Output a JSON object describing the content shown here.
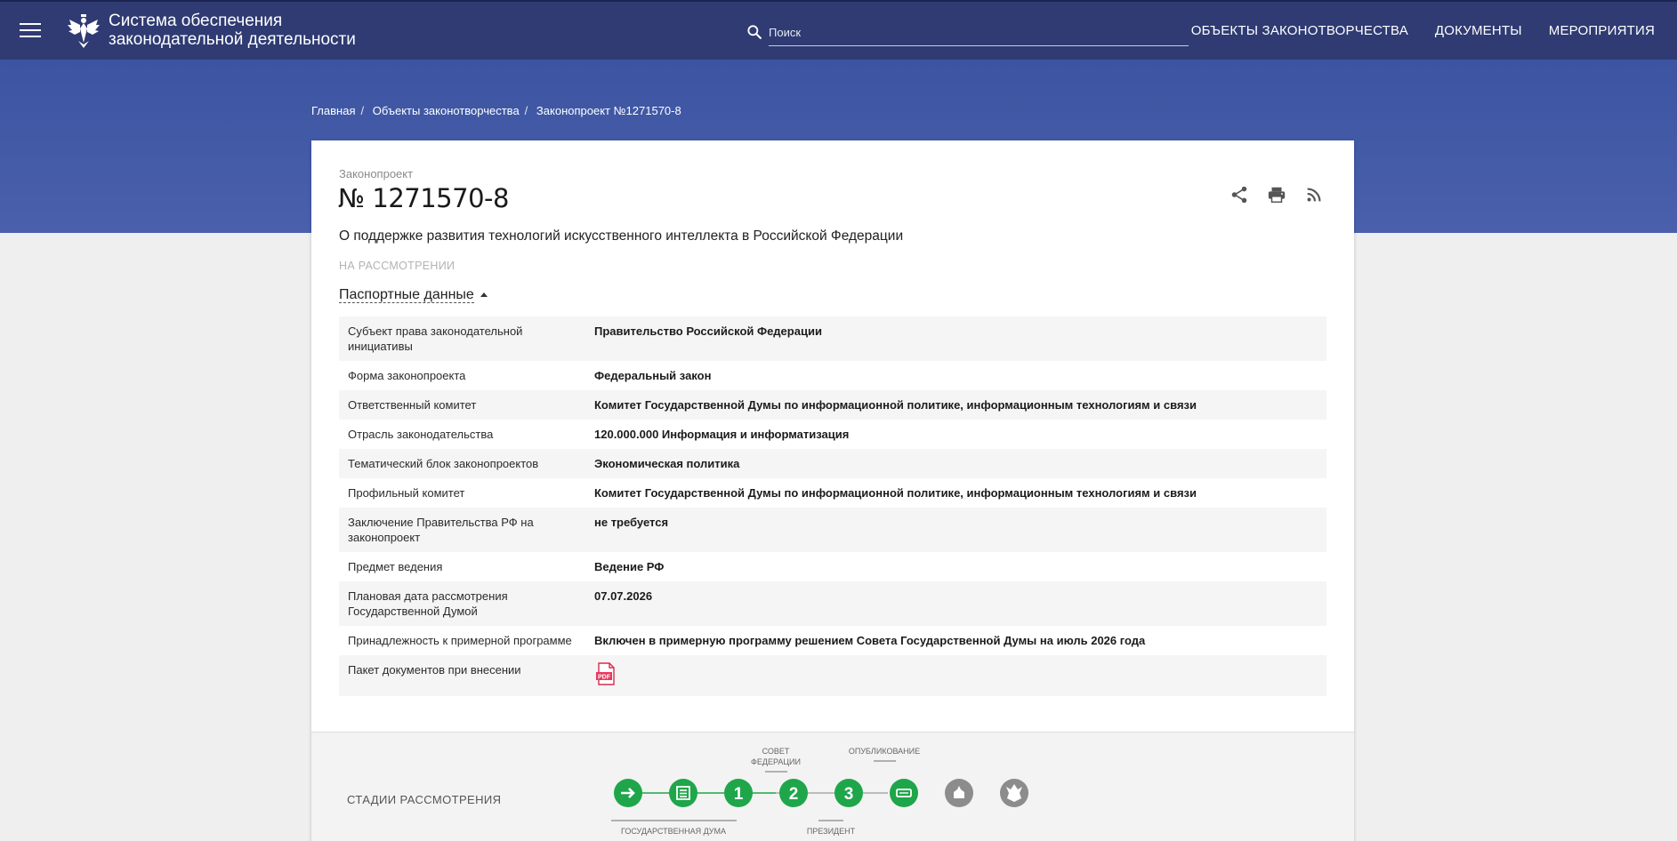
{
  "header": {
    "brand_line1": "Система обеспечения",
    "brand_line2": "законодательной деятельности",
    "search_placeholder": "Поиск",
    "nav": [
      "ОБЪЕКТЫ ЗАКОНОТВОРЧЕСТВА",
      "ДОКУМЕНТЫ",
      "МЕРОПРИЯТИЯ"
    ]
  },
  "breadcrumb": [
    "Главная",
    "Объекты законотворчества",
    "Законопроект №1271570-8"
  ],
  "bill": {
    "type": "Законопроект",
    "number": "№ 1271570-8",
    "title": "О поддержке развития технологий искусственного интеллекта в Российской Федерации",
    "status": "НА РАССМОТРЕНИИ"
  },
  "passport": {
    "toggle_label": "Паспортные данные",
    "rows": [
      {
        "key": "Субъект права законодательной инициативы",
        "value": "Правительство Российской Федерации"
      },
      {
        "key": "Форма законопроекта",
        "value": "Федеральный закон"
      },
      {
        "key": "Ответственный комитет",
        "value": "Комитет Государственной Думы по информационной политике, информационным технологиям и связи"
      },
      {
        "key": "Отрасль законодательства",
        "value": "120.000.000 Информация и информатизация"
      },
      {
        "key": "Тематический блок законопроектов",
        "value": "Экономическая политика"
      },
      {
        "key": "Профильный комитет",
        "value": "Комитет Государственной Думы по информационной политике, информационным технологиям и связи"
      },
      {
        "key": "Заключение Правительства РФ на законопроект",
        "value": "не требуется"
      },
      {
        "key": "Предмет ведения",
        "value": "Ведение РФ"
      },
      {
        "key": "Плановая дата рассмотрения Государственной Думой",
        "value": "07.07.2026"
      },
      {
        "key": "Принадлежность к примерной программе",
        "value": "Включен в примерную программу решением Совета Государственной Думы на июль 2026 года"
      },
      {
        "key": "Пакет документов при внесении",
        "value": ""
      }
    ],
    "pdf_label": "PDF"
  },
  "stages": {
    "label": "СТАДИИ РАССМОТРЕНИЯ",
    "group_top_1": "СОВЕТ",
    "group_top_2": "ФЕДЕРАЦИИ",
    "group_top_3": "ОПУБЛИКОВАНИЕ",
    "group_bottom_1": "ГОСУДАРСТВЕННАЯ ДУМА",
    "group_bottom_2": "ПРЕЗИДЕНТ",
    "step_numbers": [
      "1",
      "2",
      "3"
    ],
    "active_color": "#1fa64a",
    "inactive_color": "#8c8c8c"
  },
  "colors": {
    "header_bg": "#2f3b72",
    "banner_bg": "#4258a8"
  }
}
